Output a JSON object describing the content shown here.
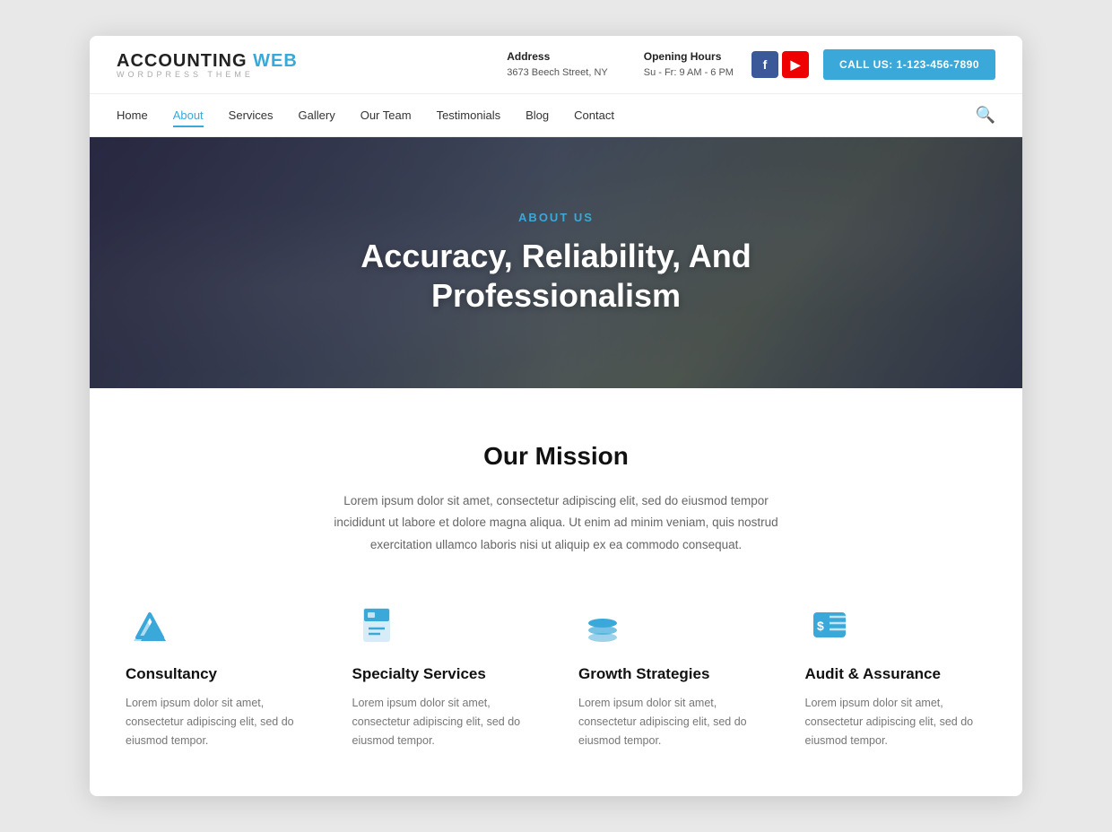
{
  "site": {
    "name_main": "ACCOUNTING",
    "name_accent": " WEB",
    "name_sub": "WORDPRESS THEME",
    "address_label": "Address",
    "address_value": "3673 Beech Street, NY",
    "hours_label": "Opening Hours",
    "hours_value": "Su - Fr: 9 AM - 6 PM",
    "call_btn": "CALL US: 1-123-456-7890"
  },
  "nav": {
    "items": [
      {
        "label": "Home",
        "active": false
      },
      {
        "label": "About",
        "active": true
      },
      {
        "label": "Services",
        "active": false
      },
      {
        "label": "Gallery",
        "active": false
      },
      {
        "label": "Our Team",
        "active": false
      },
      {
        "label": "Testimonials",
        "active": false
      },
      {
        "label": "Blog",
        "active": false
      },
      {
        "label": "Contact",
        "active": false
      }
    ]
  },
  "hero": {
    "subtitle": "ABOUT US",
    "title": "Accuracy, Reliability, And Professionalism"
  },
  "mission": {
    "title": "Our Mission",
    "text": "Lorem ipsum dolor sit amet, consectetur adipiscing elit, sed do eiusmod tempor incididunt ut labore et dolore magna aliqua. Ut enim ad minim veniam, quis nostrud exercitation ullamco laboris nisi ut aliquip ex ea commodo consequat."
  },
  "services": [
    {
      "icon": "consultancy",
      "title": "Consultancy",
      "text": "Lorem ipsum dolor sit amet, consectetur adipiscing elit, sed do eiusmod tempor."
    },
    {
      "icon": "specialty",
      "title": "Specialty Services",
      "text": "Lorem ipsum dolor sit amet, consectetur adipiscing elit, sed do eiusmod tempor."
    },
    {
      "icon": "growth",
      "title": "Growth Strategies",
      "text": "Lorem ipsum dolor sit amet, consectetur adipiscing elit, sed do eiusmod tempor."
    },
    {
      "icon": "audit",
      "title": "Audit & Assurance",
      "text": "Lorem ipsum dolor sit amet, consectetur adipiscing elit, sed do eiusmod tempor."
    }
  ],
  "colors": {
    "accent": "#3aa8d8",
    "facebook": "#3b5998",
    "youtube": "#cc0000"
  }
}
